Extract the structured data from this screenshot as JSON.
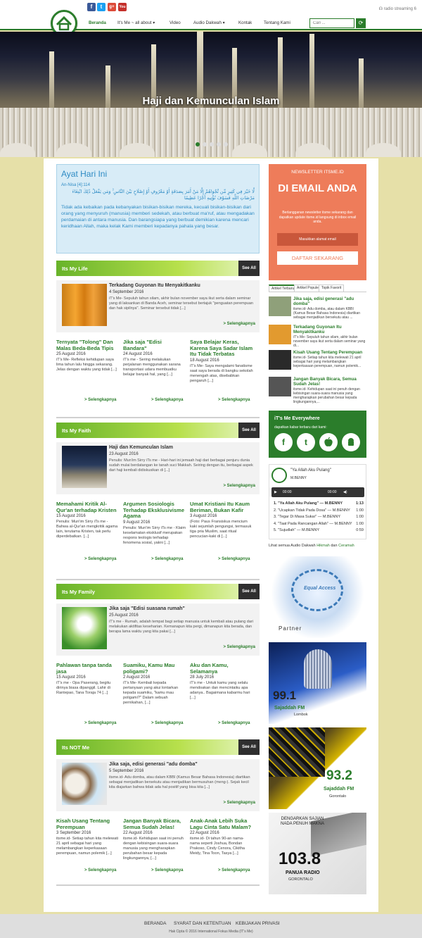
{
  "social": {
    "facebook": "f",
    "twitter": "t",
    "google": "g+",
    "youtube": "You"
  },
  "stream_label": "radio streaming 6",
  "nav": {
    "items": [
      "Beranda",
      "It's Me ~ all about ▾",
      "Video",
      "Audio Dakwah ▾",
      "Kontak",
      "Tentang Kami"
    ],
    "search_placeholder": "Cari ...",
    "search_icon": "⟳"
  },
  "hero": {
    "title": "Haji dan Kemunculan Islam"
  },
  "ayat": {
    "heading": "Ayat Hari Ini",
    "ref": "An-Nisa [4]:114",
    "arabic": "لَّا خَيْرَ فِي كَثِيرٍ مِّن نَّجْوَاهُمْ إِلَّا مَنْ أَمَرَ بِصَدَقَةٍ أَوْ مَعْرُوفٍ أَوْ إِصْلَاحٍ بَيْنَ النَّاسِ ۚ وَمَن يَفْعَلْ ذَٰلِكَ ابْتِغَاءَ مَرْضَاتِ اللَّهِ فَسَوْفَ نُؤْتِيهِ أَجْرًا عَظِيمًا",
    "translation": "Tidak ada kebaikan pada kebanyakan bisikan-bisikan mereka, kecuali bisikan-bisikan dari orang yang menyuruh (manusia) memberi sedekah, atau berbuat ma'ruf, atau mengadakan perdamaian di antara manusia. Dan barangsiapa yang berbuat demikian karena mencari keridhaan Allah, maka kelak Kami memberi kepadanya pahala yang besar."
  },
  "see_all": "See All",
  "more": "> Selengkapnya",
  "sections": [
    {
      "title": "Its My Life",
      "featured": {
        "title": "Terkadang Guyonan Itu Menyakitkanku",
        "date": "4 September 2016",
        "excerpt": "iT's Me- Sepuluh tahun silam, akhir bulan november saya ikut serta dalam seminar yang di laksankan di Banda Aceh, seminar tersebut bertajuk \"penguatan perempuan dan hak sipilnya\". Seminar tersebut tidak [...]"
      },
      "posts": [
        {
          "title": "Ternyata \"Tolong\" Dan Malas Beda-Beda Tipis",
          "date": "25 August 2016",
          "excerpt": "iT's Me- Refleksi kehidupan saya lima tahun lalu hingga sekarang. Jelas dengan waktu yang tidak [...]"
        },
        {
          "title": "Jika saja \"Edisi Bandara\"",
          "date": "24 August 2016",
          "excerpt": "iT's me - Sering melakukan perjalanan menggunakan sarana transportasi udara membuatku belajar banyak hal, yang [...]"
        },
        {
          "title": "Saya Belajar Keras, Karena Saya Sadar Islam Itu Tidak Terbatas",
          "date": "18 August 2016",
          "excerpt": "iT's Me- Saya mengalami fanatisme saat saya berada di bangku sekolah menengah atas, disebabkan pengaruh [...]"
        }
      ]
    },
    {
      "title": "Its My Faith",
      "featured": {
        "title": "Haji dan Kemunculan Islam",
        "date": "23 August 2016",
        "excerpt": "Penulis: Mun'im Sirry iTs me - Hari-hari ini jemaah haji dari berbagai penjuru dunia sudah mulai berdatangan ke tanah suci Makkah. Seiring dengan itu, berbagai aspek dari haji kembali didiskusikan di [...]"
      },
      "posts": [
        {
          "title": "Memahami Kritik Al-Qur'an terhadap Kristen",
          "date": "15 August 2016",
          "excerpt": "Penulis: Mun'im Sirry iTs me - Bahwa al-Qur'an mengkritik agama lain, terutama Kristen, tak perlu diperdebatkan. [...]"
        },
        {
          "title": "Argumen Sosiologis Terhadap Eksklusivisme Agama",
          "date": "9 August 2016",
          "excerpt": "Penulis: Mun'im Sirry iTs me - Klaim keselamatan eksklusif merupakan respons teologis terhadap fenomena sosial, yakni [...]"
        },
        {
          "title": "Umat Kristiani Itu Kaum Beriman, Bukan Kafir",
          "date": "3 August 2016",
          "excerpt": "(Foto: Paus Fransiskus mencium kaki sejumlah pengungsi, termasuk tiga pria Muslim, saat ritual pencucian-kaki di [...]"
        }
      ]
    },
    {
      "title": "Its My Family",
      "featured": {
        "title": "Jika saja \"Edisi suasana rumah\"",
        "date": "25 August 2016",
        "excerpt": "iT's me - Rumah, adalah tempat bagi setiap manusia untuk kembali atau pulang dari melakukan aktifitas keseharian. Kemanapun kita pergi, dimanapun kita berada, dan berapa lama waktu yang kita pakai [...]"
      },
      "posts": [
        {
          "title": "Pahlawan tanpa tanda jasa",
          "date": "15 August 2016",
          "excerpt": "iT's me - Opa Paserang, begitu dirinya biasa dipanggil. Lahir di Rantepao, Tana Toraja 74 [...]"
        },
        {
          "title": "Suamiku, Kamu Mau poligami?",
          "date": "2 August 2016",
          "excerpt": "iT's Me- Kembali kepada pertanyaan yang akui lontarkan kepada suamiku, \"kamu mau poligami?\" Dalam sebuah pernikahan, [...]"
        },
        {
          "title": "Aku dan Kamu, Selamanya",
          "date": "28 July 2016",
          "excerpt": "iT's me - Untuk kamu yang selalu mendoakan dan mencintaiku apa adanya.. Bagaimana kabarmu hari [...]"
        }
      ]
    },
    {
      "title": "Its NOT Me",
      "featured": {
        "title": "Jika saja, edisi generasi \"adu domba\"",
        "date": "5 September 2016",
        "excerpt": "itsme.id- Adu domba, atau dalam KBBI (Kamus Besar Bahasa Indonesia) diartikan sebagai menjadikan bersekutu atau menjadikan bermusuhan (meng-). Sejak kecil kita diajarkan bahwa tidak ada hal positif yang bisa kita [...]"
      },
      "posts": [
        {
          "title": "Kisah Usang Tentang Perempuan",
          "date": "3 September 2016",
          "excerpt": "itsme.id- Setiap tahun kita melewati 21 april sebagai hari yang melambangkan keperkasaan perempuan, namun polemik [...]"
        },
        {
          "title": "Jangan Banyak Bicara, Semua Sudah Jelas!",
          "date": "22 August 2016",
          "excerpt": "itsme.id- Kehidupan saat ini penuh dengan kebisingan suara-suara manusia yang mengharapkan perubahan besar kepada lingkungannya, [...]"
        },
        {
          "title": "Anak-Anak Lebih Suka Lagu Cinta Satu Malam?",
          "date": "22 August 2016",
          "excerpt": "itsme.id- Di tahun 90-an nama-nama seperti Joshua, Bondan Prakoso, Cindy Cenora, Cikitha Meidy, Tina Toon, Tasya [...]"
        }
      ]
    }
  ],
  "newsletter": {
    "heading": "NEWSLETTER ITSME.ID",
    "big": "DI EMAIL ANDA",
    "sub": "Berlangganan newsletter itsme sekarang dan dapatkan update itsme.id langsung di inbox email anda.",
    "input": "Masukkan alamat email",
    "button": "DAFTAR SEKARANG"
  },
  "tabs": [
    "Artikel Terbaru",
    "Artikel Populer",
    "Topik Favorit"
  ],
  "sideposts": [
    {
      "title": "Jika saja, edisi generasi \"adu domba\"",
      "excerpt": "itsme.id- Adu domba, atau dalam KBBI (Kamus Besar Bahasa Indonesia) diartikan sebagai menjadikan bersekutu atau ..."
    },
    {
      "title": "Terkadang Guyonan Itu Menyakitkanku",
      "excerpt": "iT's Me- Sepuluh tahun silam, akhir bulan november saya ikut serta dalam seminar yang di..."
    },
    {
      "title": "Kisah Usang Tentang Perempuan",
      "excerpt": "itsme.id- Setiap tahun kita melewati 21 april sebagai hari yang melambangkan keperkasaan perempuan, namun polemik..."
    },
    {
      "title": "Jangan Banyak Bicara, Semua Sudah Jelas!",
      "excerpt": "itsme.id- Kehidupan saat ini penuh dengan kebisingan suara-suara manusia yang mengharapkan perubahan besar kepada lingkungannya,..."
    }
  ],
  "everywhere": {
    "heading": "iT's Me Everywhere",
    "sub": "dapatkan kabar terbaru dari kami:",
    "icons": [
      "f",
      "t",
      "",
      "▲"
    ]
  },
  "player": {
    "title": "\"Ya Allah Aku Pulang\"",
    "artist": "M.BENNY",
    "t0": "00:00",
    "t1": "00:00",
    "tracks": [
      {
        "name": "1. \"Ya Allah Aku Pulang\" — M.BENNY",
        "dur": "1:13"
      },
      {
        "name": "2. \"Ucapkan Tidak Pada Dosa\" — M.BENNY",
        "dur": "1:00"
      },
      {
        "name": "3. \"Tegar Di Masa Sukar\" — M.BENNY",
        "dur": "1:00"
      },
      {
        "name": "4. \"Taat Pada Rancangan Allah\" — M.BENNY",
        "dur": "1:00"
      },
      {
        "name": "5. \"Sujudlah\" — M.BENNY",
        "dur": "0:59"
      }
    ]
  },
  "audio_link": {
    "pre": "Lihat semua Audio Dakwah",
    "a": "Hikmah",
    "mid": "dan",
    "b": "Ceramah"
  },
  "banners": [
    {
      "text": "Partner",
      "sub": "Equal Access"
    },
    {
      "text": "99.1",
      "sub": "Sajaddah FM",
      "sub2": "Lombok"
    },
    {
      "text": "93.2",
      "sub": "Sajaddah FM",
      "sub2": "Gorontalo"
    },
    {
      "text": "103.8",
      "sub": "PANUA RADIO",
      "sub2": "GORONTALO",
      "top": "DENGARKAN SAJIAN NADA PENUH MAKNA"
    }
  ],
  "footer": {
    "links": [
      "BERANDA",
      "SYARAT DAN KETENTUAN",
      "KEBIJAKAN PRIVASI"
    ],
    "copy": "Hak Cipta © 2016 International Fokus Media (IT's Me)"
  }
}
